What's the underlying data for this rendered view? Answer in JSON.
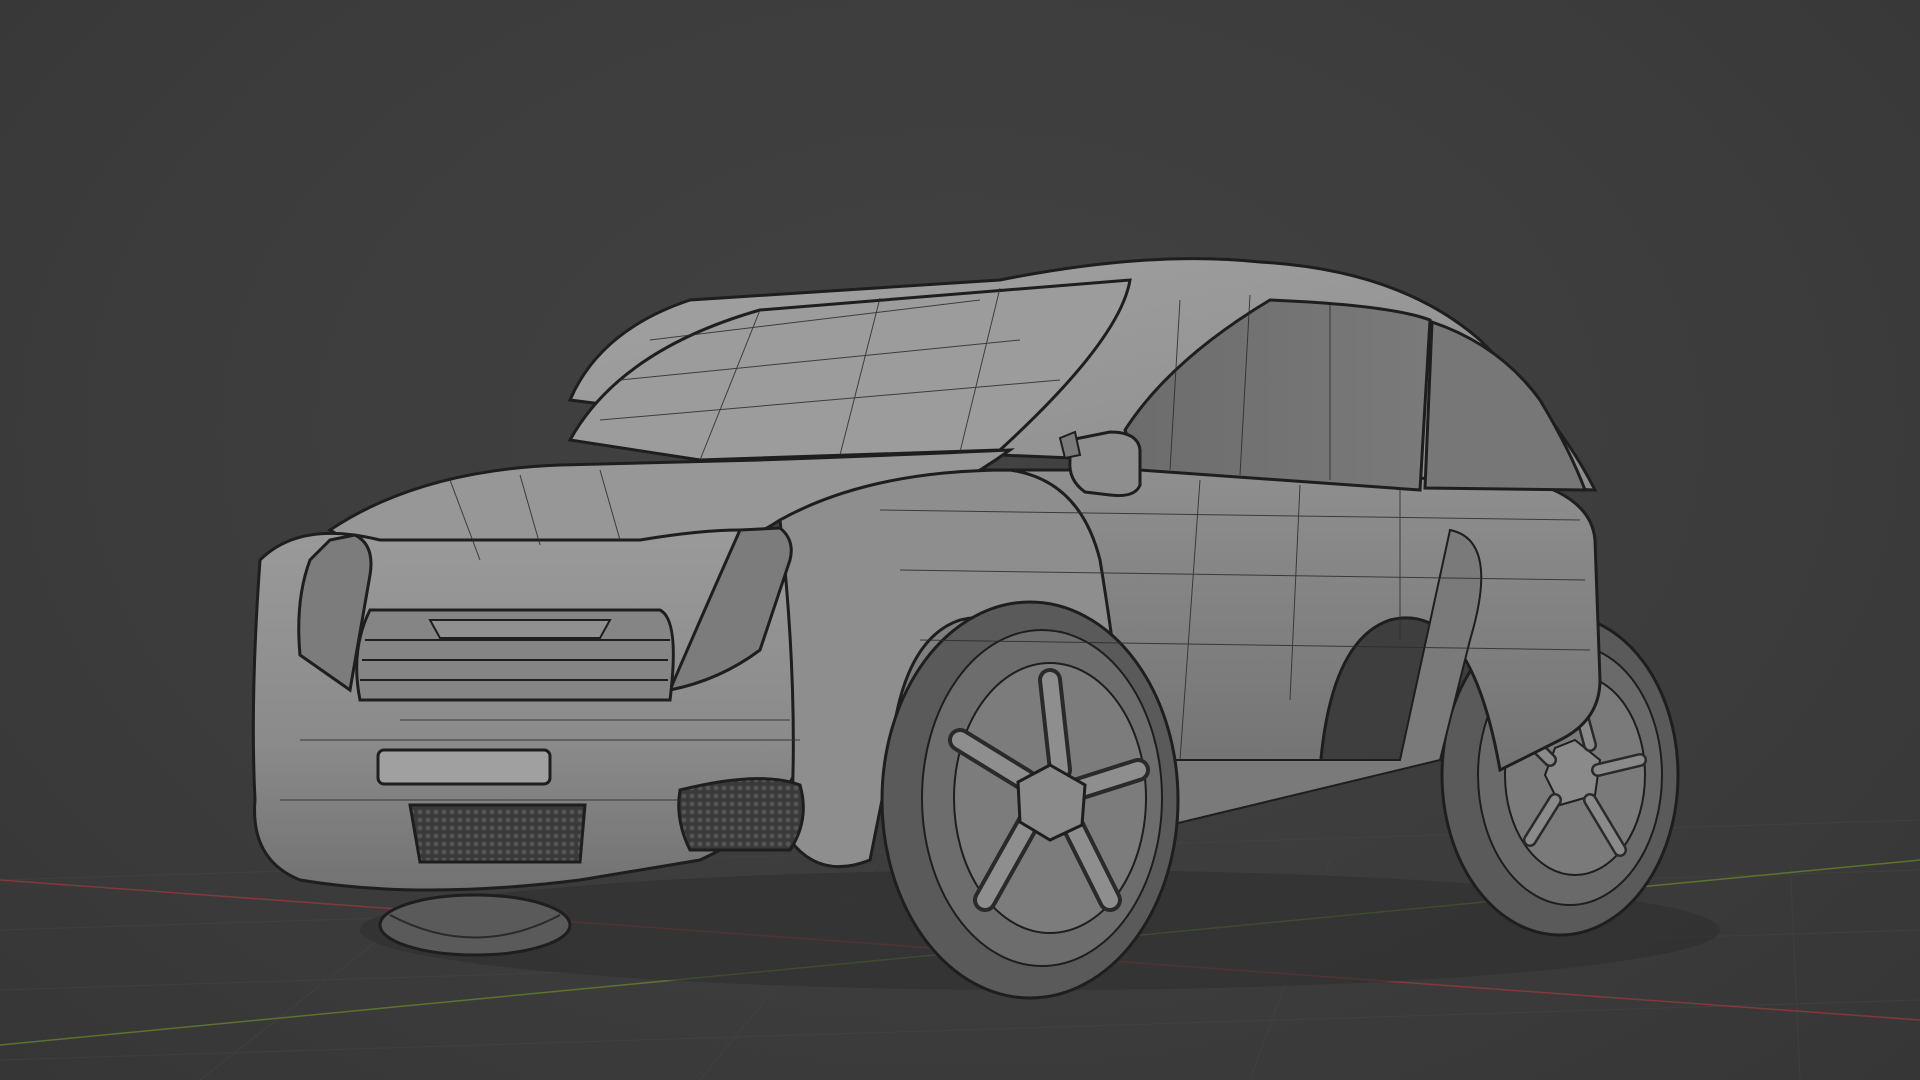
{
  "viewport": {
    "background_color": "#3d3d3d",
    "grid_color": "#454545",
    "x_axis_color": "#8a3a3a",
    "y_axis_color": "#5e7a2e",
    "shading": "solid",
    "overlay": "wireframe"
  },
  "model": {
    "subject": "car",
    "base_color": "#8c8c8c",
    "wire_color": "#1e1e1e",
    "glass_color": "#6c6c6c",
    "tire_color": "#5a5a5a"
  }
}
